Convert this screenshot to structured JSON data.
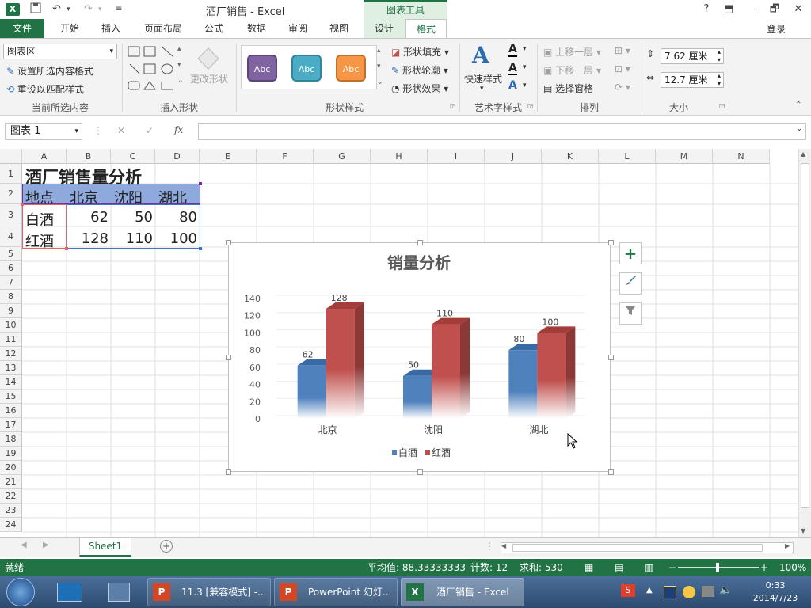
{
  "titlebar": {
    "app_badge": "X",
    "title": "酒厂销售 - Excel",
    "chart_tools": "图表工具",
    "help": "?",
    "win_restore_ribbon": "⬒",
    "win_min": "—",
    "win_max": "🗗",
    "win_close": "✕"
  },
  "tabs": {
    "file": "文件",
    "home": "开始",
    "insert": "插入",
    "page_layout": "页面布局",
    "formulas": "公式",
    "data": "数据",
    "review": "审阅",
    "view": "视图",
    "design": "设计",
    "format": "格式",
    "login": "登录"
  },
  "ribbon": {
    "current_selection": {
      "combo_value": "图表区",
      "format_selection": "设置所选内容格式",
      "reset_style": "重设以匹配样式",
      "label": "当前所选内容"
    },
    "insert_shapes": {
      "change_shape": "更改形状",
      "label": "插入形状"
    },
    "shape_styles": {
      "swatch1": "Abc",
      "swatch2": "Abc",
      "swatch3": "Abc",
      "fill": "形状填充",
      "outline": "形状轮廓",
      "effects": "形状效果",
      "label": "形状样式"
    },
    "wordart": {
      "quick_styles": "快速样式",
      "label": "艺术字样式"
    },
    "arrange": {
      "bring_forward": "上移一层",
      "send_backward": "下移一层",
      "selection_pane": "选择窗格",
      "label": "排列"
    },
    "size": {
      "height": "7.62 厘米",
      "width": "12.7 厘米",
      "label": "大小"
    }
  },
  "formula_bar": {
    "name_box": "图表 1",
    "fx": "fx",
    "cancel": "✕",
    "enter": "✓"
  },
  "columns": [
    "A",
    "B",
    "C",
    "D",
    "E",
    "F",
    "G",
    "H",
    "I",
    "J",
    "K",
    "L",
    "M",
    "N"
  ],
  "rows": [
    "1",
    "2",
    "3",
    "4",
    "5",
    "6",
    "7",
    "8",
    "9",
    "10",
    "11",
    "12",
    "13",
    "14",
    "15",
    "16",
    "17",
    "18",
    "19",
    "20",
    "21",
    "22",
    "23",
    "24"
  ],
  "cells": {
    "a1": "酒厂销售量分析",
    "a2": "地点",
    "b2": "北京",
    "c2": "沈阳",
    "d2": "湖北",
    "a3": "白酒",
    "b3": "62",
    "c3": "50",
    "d3": "80",
    "a4": "红酒",
    "b4": "128",
    "c4": "110",
    "d4": "100"
  },
  "chart_data": {
    "type": "bar",
    "title": "销量分析",
    "categories": [
      "北京",
      "沈阳",
      "湖北"
    ],
    "series": [
      {
        "name": "白酒",
        "values": [
          62,
          50,
          80
        ],
        "color": "#4f81bd"
      },
      {
        "name": "红酒",
        "values": [
          128,
          110,
          100
        ],
        "color": "#c0504d"
      }
    ],
    "y_ticks": [
      "0",
      "20",
      "40",
      "60",
      "80",
      "100",
      "120",
      "140"
    ],
    "ylim": [
      0,
      140
    ],
    "legend": "bottom",
    "data_labels": true
  },
  "chart_side_buttons": {
    "add": "+",
    "style": "🖌",
    "filter": "⏷"
  },
  "sheet_tab": "Sheet1",
  "status": {
    "ready": "就绪",
    "average": "平均值: 88.33333333",
    "count": "计数: 12",
    "sum": "求和: 530",
    "zoom": "100%"
  },
  "taskbar": {
    "task1": "11.3 [兼容模式] -...",
    "task2": "PowerPoint 幻灯...",
    "task3": "酒厂销售 - Excel",
    "time": "0:33",
    "date": "2014/7/23"
  }
}
